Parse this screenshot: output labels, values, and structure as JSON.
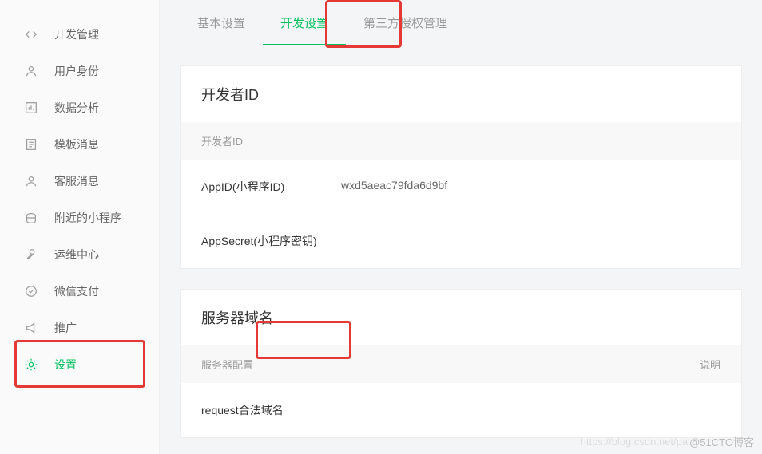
{
  "sidebar": {
    "items": [
      {
        "label": "开发管理",
        "icon": "code-icon"
      },
      {
        "label": "用户身份",
        "icon": "user-icon"
      },
      {
        "label": "数据分析",
        "icon": "chart-icon"
      },
      {
        "label": "模板消息",
        "icon": "template-icon"
      },
      {
        "label": "客服消息",
        "icon": "service-icon"
      },
      {
        "label": "附近的小程序",
        "icon": "nearby-icon"
      },
      {
        "label": "运维中心",
        "icon": "ops-icon"
      },
      {
        "label": "微信支付",
        "icon": "pay-icon"
      },
      {
        "label": "推广",
        "icon": "promo-icon"
      },
      {
        "label": "设置",
        "icon": "settings-icon"
      }
    ]
  },
  "tabs": [
    {
      "label": "基本设置"
    },
    {
      "label": "开发设置"
    },
    {
      "label": "第三方授权管理"
    }
  ],
  "devid_panel": {
    "title": "开发者ID",
    "table_header": "开发者ID",
    "rows": [
      {
        "label": "AppID(小程序ID)",
        "value": "wxd5aeac79fda6d9bf"
      },
      {
        "label": "AppSecret(小程序密钥)",
        "value": ""
      }
    ]
  },
  "domain_panel": {
    "title": "服务器域名",
    "header_col1": "服务器配置",
    "header_col2": "说明",
    "rows": [
      {
        "label": "request合法域名",
        "value": ""
      }
    ]
  },
  "watermark": {
    "faded": "https://blog.csdn.net/pa",
    "text": "@51CTO博客"
  }
}
